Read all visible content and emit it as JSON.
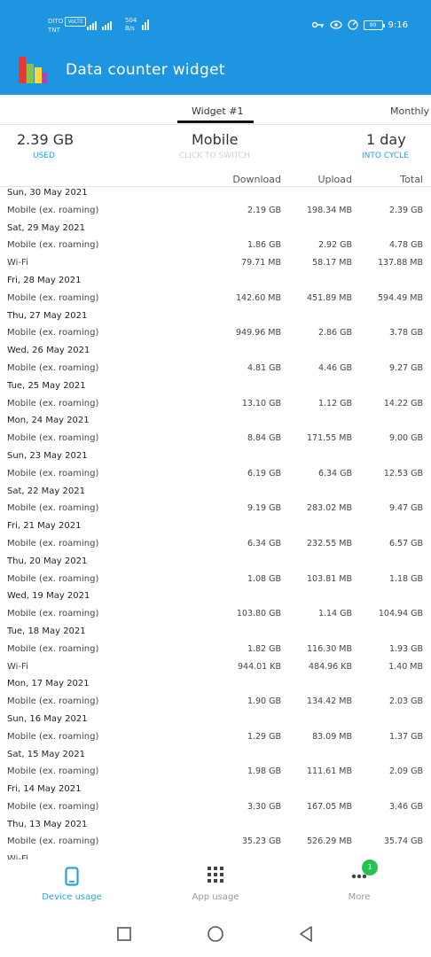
{
  "status_bar": {
    "carrier_top": "DITO",
    "volte": "VoLTE",
    "carrier_bottom": "TNT",
    "net_speed_value": "504",
    "net_speed_unit": "B/s",
    "battery_level": "90",
    "time": "9:16"
  },
  "header": {
    "title": "Data counter widget"
  },
  "tabs": {
    "active": "Widget #1",
    "other": "Monthly"
  },
  "summary": {
    "used_value": "2.39 GB",
    "used_label": "USED",
    "network_value": "Mobile",
    "network_hint": "CLICK TO SWITCH",
    "cycle_value": "1 day",
    "cycle_label": "INTO CYCLE"
  },
  "table": {
    "headers": {
      "download": "Download",
      "upload": "Upload",
      "total": "Total"
    },
    "groups": [
      {
        "date": "Sun, 30 May 2021",
        "rows": [
          {
            "label": "Mobile (ex. roaming)",
            "download": "2.19 GB",
            "upload": "198.34 MB",
            "total": "2.39 GB"
          }
        ]
      },
      {
        "date": "Sat, 29 May 2021",
        "rows": [
          {
            "label": "Mobile (ex. roaming)",
            "download": "1.86 GB",
            "upload": "2.92 GB",
            "total": "4.78 GB"
          },
          {
            "label": "Wi-Fi",
            "download": "79.71 MB",
            "upload": "58.17 MB",
            "total": "137.88 MB"
          }
        ]
      },
      {
        "date": "Fri, 28 May 2021",
        "rows": [
          {
            "label": "Mobile (ex. roaming)",
            "download": "142.60 MB",
            "upload": "451.89 MB",
            "total": "594.49 MB"
          }
        ]
      },
      {
        "date": "Thu, 27 May 2021",
        "rows": [
          {
            "label": "Mobile (ex. roaming)",
            "download": "949.96 MB",
            "upload": "2.86 GB",
            "total": "3.78 GB"
          }
        ]
      },
      {
        "date": "Wed, 26 May 2021",
        "rows": [
          {
            "label": "Mobile (ex. roaming)",
            "download": "4.81 GB",
            "upload": "4.46 GB",
            "total": "9.27 GB"
          }
        ]
      },
      {
        "date": "Tue, 25 May 2021",
        "rows": [
          {
            "label": "Mobile (ex. roaming)",
            "download": "13.10 GB",
            "upload": "1.12 GB",
            "total": "14.22 GB"
          }
        ]
      },
      {
        "date": "Mon, 24 May 2021",
        "rows": [
          {
            "label": "Mobile (ex. roaming)",
            "download": "8.84 GB",
            "upload": "171.55 MB",
            "total": "9.00 GB"
          }
        ]
      },
      {
        "date": "Sun, 23 May 2021",
        "rows": [
          {
            "label": "Mobile (ex. roaming)",
            "download": "6.19 GB",
            "upload": "6.34 GB",
            "total": "12.53 GB"
          }
        ]
      },
      {
        "date": "Sat, 22 May 2021",
        "rows": [
          {
            "label": "Mobile (ex. roaming)",
            "download": "9.19 GB",
            "upload": "283.02 MB",
            "total": "9.47 GB"
          }
        ]
      },
      {
        "date": "Fri, 21 May 2021",
        "rows": [
          {
            "label": "Mobile (ex. roaming)",
            "download": "6.34 GB",
            "upload": "232.55 MB",
            "total": "6.57 GB"
          }
        ]
      },
      {
        "date": "Thu, 20 May 2021",
        "rows": [
          {
            "label": "Mobile (ex. roaming)",
            "download": "1.08 GB",
            "upload": "103.81 MB",
            "total": "1.18 GB"
          }
        ]
      },
      {
        "date": "Wed, 19 May 2021",
        "rows": [
          {
            "label": "Mobile (ex. roaming)",
            "download": "103.80 GB",
            "upload": "1.14 GB",
            "total": "104.94 GB"
          }
        ]
      },
      {
        "date": "Tue, 18 May 2021",
        "rows": [
          {
            "label": "Mobile (ex. roaming)",
            "download": "1.82 GB",
            "upload": "116.30 MB",
            "total": "1.93 GB"
          },
          {
            "label": "Wi-Fi",
            "download": "944.01 KB",
            "upload": "484.96 KB",
            "total": "1.40 MB"
          }
        ]
      },
      {
        "date": "Mon, 17 May 2021",
        "rows": [
          {
            "label": "Mobile (ex. roaming)",
            "download": "1.90 GB",
            "upload": "134.42 MB",
            "total": "2.03 GB"
          }
        ]
      },
      {
        "date": "Sun, 16 May 2021",
        "rows": [
          {
            "label": "Mobile (ex. roaming)",
            "download": "1.29 GB",
            "upload": "83.09 MB",
            "total": "1.37 GB"
          }
        ]
      },
      {
        "date": "Sat, 15 May 2021",
        "rows": [
          {
            "label": "Mobile (ex. roaming)",
            "download": "1.98 GB",
            "upload": "111.61 MB",
            "total": "2.09 GB"
          }
        ]
      },
      {
        "date": "Fri, 14 May 2021",
        "rows": [
          {
            "label": "Mobile (ex. roaming)",
            "download": "3.30 GB",
            "upload": "167.05 MB",
            "total": "3.46 GB"
          }
        ]
      },
      {
        "date": "Thu, 13 May 2021",
        "rows": [
          {
            "label": "Mobile (ex. roaming)",
            "download": "35.23 GB",
            "upload": "526.29 MB",
            "total": "35.74 GB"
          },
          {
            "label": "Wi-Fi",
            "download": "",
            "upload": "",
            "total": ""
          }
        ]
      }
    ]
  },
  "bottom_nav": {
    "items": [
      {
        "label": "Device usage",
        "icon": "phone-icon"
      },
      {
        "label": "App usage",
        "icon": "grid-icon"
      },
      {
        "label": "More",
        "icon": "more-dots-icon"
      }
    ],
    "more_badge": "1"
  },
  "colors": {
    "header_bg": "#1e95e0",
    "accent": "#2a9fe4",
    "badge": "#25c153"
  }
}
